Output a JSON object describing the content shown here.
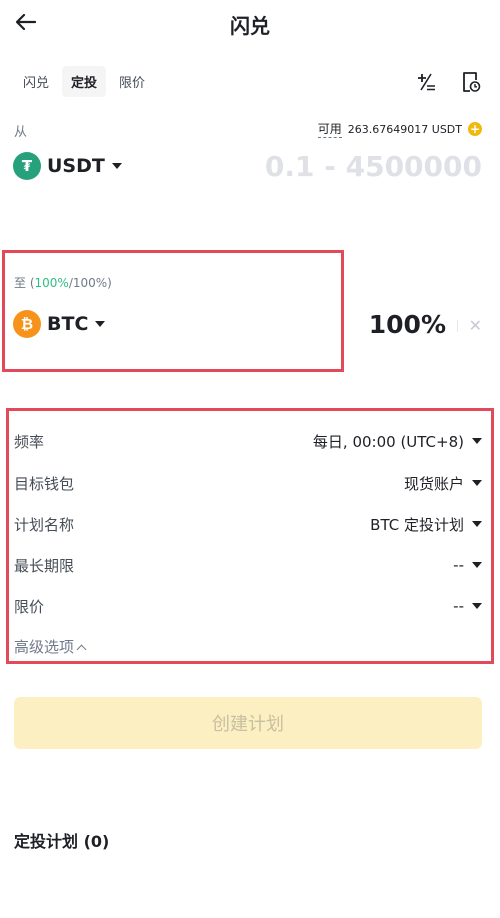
{
  "header": {
    "title": "闪兑",
    "back_icon": "arrow-left-icon"
  },
  "tabs": [
    {
      "label": "闪兑",
      "active": false
    },
    {
      "label": "定投",
      "active": true
    },
    {
      "label": "限价",
      "active": false
    }
  ],
  "toolbar": {
    "icons": [
      "plus-minus-icon",
      "history-icon"
    ]
  },
  "from": {
    "label": "从",
    "available_label": "可用",
    "available_value": "263.67649017 USDT",
    "coin": "USDT",
    "coin_icon": "tether-icon",
    "amount_placeholder": "0.1 - 4500000"
  },
  "to": {
    "label_prefix": "至 (",
    "label_green": "100%",
    "label_suffix": "/100%)",
    "coin": "BTC",
    "coin_icon": "bitcoin-icon",
    "percent": "100%"
  },
  "settings": [
    {
      "label": "频率",
      "value": "每日, 00:00 (UTC+8)"
    },
    {
      "label": "目标钱包",
      "value": "现货账户"
    },
    {
      "label": "计划名称",
      "value": "BTC 定投计划"
    },
    {
      "label": "最长期限",
      "value": "--"
    },
    {
      "label": "限价",
      "value": "--"
    }
  ],
  "advanced": {
    "label": "高级选项"
  },
  "create_button": {
    "label": "创建计划"
  },
  "plans": {
    "title": "定投计划 (0)"
  },
  "colors": {
    "accent": "#f0b90b",
    "highlight_box": "#e24a5a",
    "green": "#2ebd85",
    "tether": "#26a17b",
    "bitcoin": "#f7931a"
  }
}
